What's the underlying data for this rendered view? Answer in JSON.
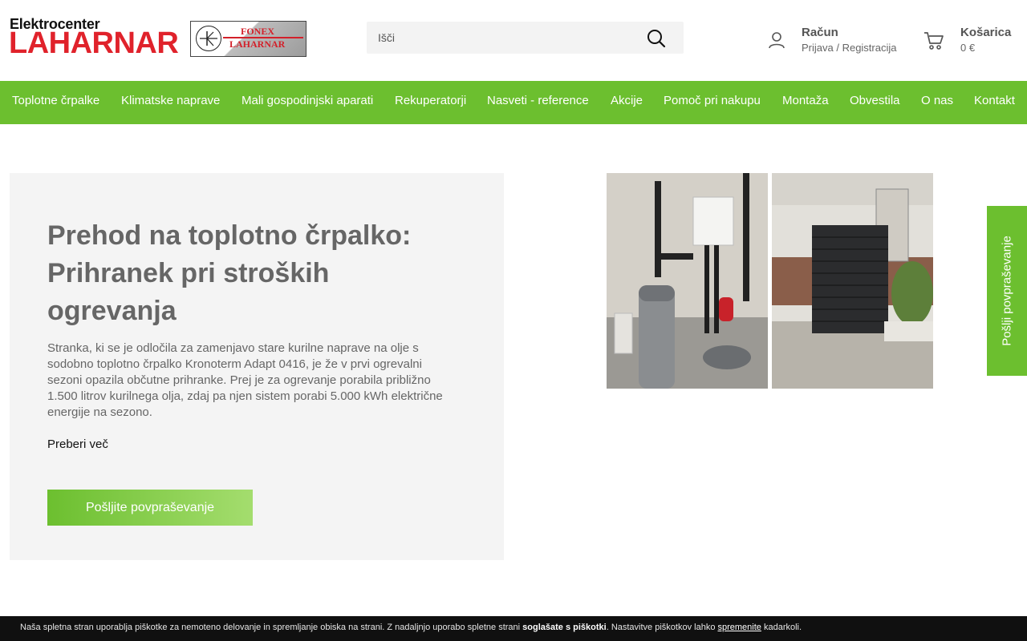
{
  "header": {
    "logo_top": "Elektrocenter",
    "logo_main": "LAHARNAR",
    "logo2_line1": "FONEX",
    "logo2_line2": "LAHARNAR",
    "search_placeholder": "Išči",
    "account_title": "Račun",
    "account_sub": "Prijava / Registracija",
    "cart_title": "Košarica",
    "cart_amount": "0 €"
  },
  "nav": {
    "items": [
      "Toplotne črpalke",
      "Klimatske naprave",
      "Mali gospodinjski aparati",
      "Rekuperatorji",
      "Nasveti - reference",
      "Akcije",
      "Pomoč pri nakupu",
      "Montaža",
      "Obvestila",
      "O nas",
      "Kontakt"
    ]
  },
  "hero": {
    "title": "Prehod na toplotno črpalko: Prihranek pri stroških ogrevanja",
    "text": "Stranka, ki se je odločila za zamenjavo stare kurilne naprave na olje s sodobno toplotno črpalko Kronoterm Adapt 0416, je že v prvi ogrevalni sezoni opazila občutne prihranke. Prej je za ogrevanje porabila približno 1.500 litrov kurilnega olja, zdaj pa njen sistem porabi 5.000 kWh električne energije na sezono.",
    "read_more": "Preberi več",
    "button": "Pošljite povpraševanje"
  },
  "side_tab": "Pošlji povpraševanje",
  "cookie": {
    "text_before": "Naša spletna stran uporablja piškotke za nemoteno delovanje in spremljanje obiska na strani. Z nadaljnjo uporabo spletne strani ",
    "bold": "soglašate s piškotki",
    "text_middle": ". Nastavitve piškotkov lahko ",
    "link": "spremenite",
    "text_after": " kadarkoli."
  },
  "colors": {
    "brand_green": "#6cbf2f",
    "brand_red": "#e0222b",
    "cookie_bar": "#101010"
  },
  "icons": {
    "search": "search-icon",
    "account": "user-icon",
    "cart": "cart-icon"
  }
}
